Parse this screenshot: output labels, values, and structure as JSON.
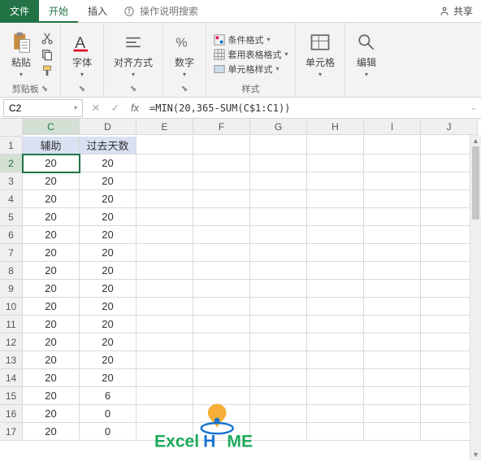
{
  "tabs": {
    "file": "文件",
    "home": "开始",
    "insert": "插入",
    "search_placeholder": "操作说明搜索",
    "share": "共享"
  },
  "ribbon": {
    "clipboard": {
      "paste": "粘贴",
      "label": "剪贴板"
    },
    "font": {
      "btn": "字体",
      "label": "字体"
    },
    "align": {
      "btn": "对齐方式",
      "label": "对齐方式"
    },
    "number": {
      "btn": "数字",
      "label": "数字"
    },
    "styles": {
      "conditional": "条件格式",
      "table": "套用表格格式",
      "cell": "单元格样式",
      "label": "样式"
    },
    "cells": {
      "btn": "单元格",
      "label": "单元格"
    },
    "editing": {
      "btn": "编辑",
      "label": "编辑"
    }
  },
  "formula_bar": {
    "cell_ref": "C2",
    "formula": "=MIN(20,365-SUM(C$1:C1))"
  },
  "columns": [
    "C",
    "D",
    "E",
    "F",
    "G",
    "H",
    "I",
    "J"
  ],
  "headers": {
    "c": "辅助",
    "d": "过去天数"
  },
  "rows": [
    {
      "n": 2,
      "c": "20",
      "d": "20"
    },
    {
      "n": 3,
      "c": "20",
      "d": "20"
    },
    {
      "n": 4,
      "c": "20",
      "d": "20"
    },
    {
      "n": 5,
      "c": "20",
      "d": "20"
    },
    {
      "n": 6,
      "c": "20",
      "d": "20"
    },
    {
      "n": 7,
      "c": "20",
      "d": "20"
    },
    {
      "n": 8,
      "c": "20",
      "d": "20"
    },
    {
      "n": 9,
      "c": "20",
      "d": "20"
    },
    {
      "n": 10,
      "c": "20",
      "d": "20"
    },
    {
      "n": 11,
      "c": "20",
      "d": "20"
    },
    {
      "n": 12,
      "c": "20",
      "d": "20"
    },
    {
      "n": 13,
      "c": "20",
      "d": "20"
    },
    {
      "n": 14,
      "c": "20",
      "d": "20"
    },
    {
      "n": 15,
      "c": "20",
      "d": "6"
    },
    {
      "n": 16,
      "c": "20",
      "d": "0"
    },
    {
      "n": 17,
      "c": "20",
      "d": "0"
    }
  ],
  "watermark": {
    "text1": "Excel",
    "text2": "H",
    "text3": "ME"
  }
}
